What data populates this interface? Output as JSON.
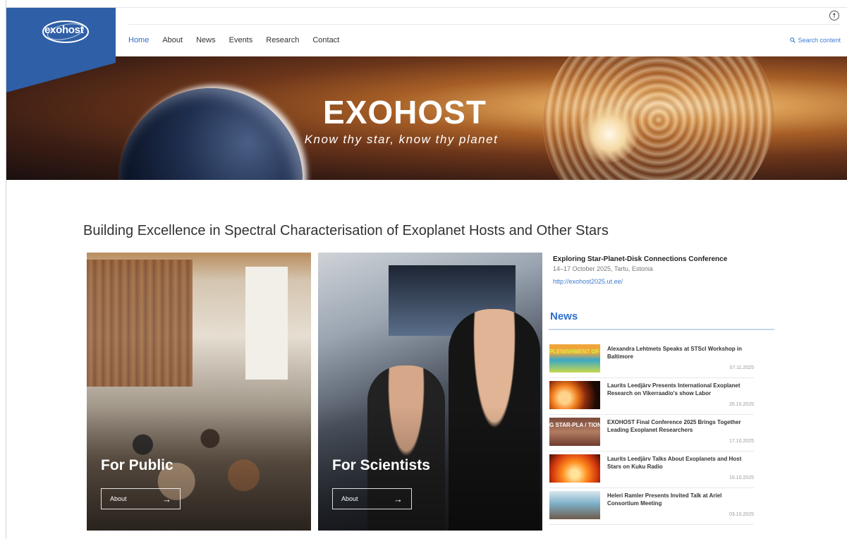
{
  "brand": {
    "logo_text": "exohost"
  },
  "header": {
    "accessibility_icon": "accessibility-icon",
    "nav": [
      {
        "label": "Home",
        "active": true
      },
      {
        "label": "About",
        "active": false
      },
      {
        "label": "News",
        "active": false
      },
      {
        "label": "Events",
        "active": false
      },
      {
        "label": "Research",
        "active": false
      },
      {
        "label": "Contact",
        "active": false
      }
    ],
    "search_label": "Search content",
    "search_icon": "search-icon"
  },
  "hero": {
    "title": "EXOHOST",
    "subtitle": "Know thy star, know thy planet"
  },
  "headline": "Building Excellence in Spectral Characterisation of Exoplanet Hosts and Other Stars",
  "cards": [
    {
      "title": "For Public",
      "button_label": "About"
    },
    {
      "title": "For Scientists",
      "button_label": "About"
    }
  ],
  "conference": {
    "title": "Exploring Star-Planet-Disk Connections Conference",
    "details": "14–17 October 2025, Tartu, Estonia",
    "link": "http://exohost2025.ut.ee/"
  },
  "news": {
    "heading": "News",
    "items": [
      {
        "title": "Alexandra Lehtmets Speaks at STScI Workshop in Baltimore",
        "date": "07.11.2025",
        "thumb_text": "PLENISHMENT OF / ANETARY SYSTEM"
      },
      {
        "title": "Laurits Leedjärv Presents International Exoplanet Research on Vikerraadio's show Labor",
        "date": "26.10.2025",
        "thumb_text": ""
      },
      {
        "title": "EXOHOST Final Conference 2025 Brings Together Leading Exoplanet Researchers",
        "date": "17.10.2025",
        "thumb_text": "G STAR-PLA / TIONS CONF"
      },
      {
        "title": "Laurits Leedjärv Talks About Exoplanets and Host Stars on Kuku Radio",
        "date": "15.10.2025",
        "thumb_text": ""
      },
      {
        "title": "Heleri Ramler Presents Invited Talk at Ariel Consortium Meeting",
        "date": "03.10.2025",
        "thumb_text": ""
      }
    ]
  },
  "colors": {
    "brand_blue": "#2f5fa7",
    "link_blue": "#3f7cd0",
    "nav_active": "#2f6fc9"
  }
}
